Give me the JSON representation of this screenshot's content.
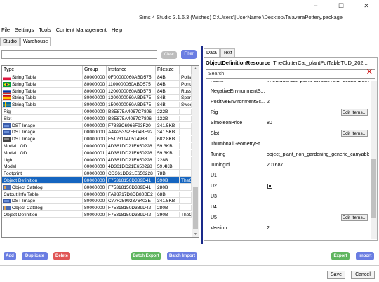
{
  "window": {
    "title": "Sims 4 Studio 3.1.6.3 (Wishes)  C:\\Users\\[UserName]\\Desktop\\TalaveraPottery.package",
    "minimize": "−",
    "maximize": "☐",
    "close": "✕"
  },
  "menu": [
    "File",
    "Settings",
    "Tools",
    "Content Management",
    "Help"
  ],
  "tabs": [
    "Studio",
    "Warehouse"
  ],
  "left": {
    "search_value": "",
    "clear_label": "Clear",
    "filter_label": "Filter",
    "columns": [
      "Type",
      "Group",
      "Instance",
      "Filesize",
      ""
    ],
    "rows": [
      {
        "type": "String Table",
        "group": "80000000",
        "instance": "0F00000060ABD575",
        "size": "84B",
        "extra": "Polish",
        "flag": "pl"
      },
      {
        "type": "String Table",
        "group": "80000000",
        "instance": "1100000060ABD575",
        "size": "84B",
        "extra": "Portug",
        "flag": "br"
      },
      {
        "type": "String Table",
        "group": "80000000",
        "instance": "1200000060ABD575",
        "size": "84B",
        "extra": "Russia",
        "flag": "ru"
      },
      {
        "type": "String Table",
        "group": "80000000",
        "instance": "1300000060ABD575",
        "size": "84B",
        "extra": "Spanis",
        "flag": "es"
      },
      {
        "type": "String Table",
        "group": "80000000",
        "instance": "1500000060ABD575",
        "size": "84B",
        "extra": "Swedis",
        "flag": "se"
      },
      {
        "type": "Rig",
        "group": "00000000",
        "instance": "B8E875A4067C7806",
        "size": "222B",
        "extra": "",
        "flag": ""
      },
      {
        "type": "Slot",
        "group": "00000000",
        "instance": "B8E875A4067C7806",
        "size": "132B",
        "extra": "",
        "flag": ""
      },
      {
        "type": "DST Image",
        "group": "00000000",
        "instance": "F7883C6966F93F20",
        "size": "341.5KB",
        "extra": "",
        "flag": "dst"
      },
      {
        "type": "DST Image",
        "group": "00000000",
        "instance": "A4A253S2EF04BE92",
        "size": "341.5KB",
        "extra": "",
        "flag": "dst"
      },
      {
        "type": "DST Image",
        "group": "00000000",
        "instance": "F51231940514988",
        "size": "682.8KB",
        "extra": "",
        "flag": "dst2"
      },
      {
        "type": "Model LOD",
        "group": "00000000",
        "instance": "4D361DD21E650228",
        "size": "59.3KB",
        "extra": "",
        "flag": ""
      },
      {
        "type": "Model LOD",
        "group": "00000001",
        "instance": "4D361DD21E650228",
        "size": "59.3KB",
        "extra": "",
        "flag": ""
      },
      {
        "type": "Light",
        "group": "00000000",
        "instance": "4D361DD21E650228",
        "size": "228B",
        "extra": "",
        "flag": ""
      },
      {
        "type": "Model",
        "group": "00000000",
        "instance": "4D361DD21E650228",
        "size": "59.4KB",
        "extra": "",
        "flag": ""
      },
      {
        "type": "Footprint",
        "group": "80000000",
        "instance": "CD361DD21E650228",
        "size": "78B",
        "extra": "",
        "flag": ""
      },
      {
        "type": "Object Definition",
        "group": "80000000",
        "instance": "F75318150D389D41",
        "size": "390B",
        "extra": "TheClu",
        "flag": "",
        "selected": true
      },
      {
        "type": "Object Catalog",
        "group": "80000000",
        "instance": "F75318150D389D41",
        "size": "280B",
        "extra": "",
        "flag": "cat"
      },
      {
        "type": "Cutout Info Table",
        "group": "80000000",
        "instance": "FA93717D8DB80BE2",
        "size": "68B",
        "extra": "",
        "flag": ""
      },
      {
        "type": "DST Image",
        "group": "80000000",
        "instance": "C77F25992376403E",
        "size": "341.5KB",
        "extra": "",
        "flag": "dst"
      },
      {
        "type": "Object Catalog",
        "group": "80000000",
        "instance": "F75318150D389D42",
        "size": "280B",
        "extra": "",
        "flag": "cat"
      },
      {
        "type": "Object Definition",
        "group": "80000000",
        "instance": "F75318150D389D42",
        "size": "390B",
        "extra": "TheClu",
        "flag": ""
      }
    ]
  },
  "right": {
    "tabs": [
      "Data",
      "Text"
    ],
    "resource_type": "ObjectDefinitionResource",
    "resource_name": "TheClutterCat_plantPotTableTUD_202...",
    "search_placeholder": "Search",
    "edit_label": "Edit Items...",
    "props": [
      {
        "name": "Name",
        "value": "TheClutterCat_plantPotTableTUD_202204201403"
      },
      {
        "name": "NegativeEnvironmentS...",
        "value": ""
      },
      {
        "name": "PositiveEnvironmentSc...",
        "value": "2"
      },
      {
        "name": "Rig",
        "value": "",
        "edit": true
      },
      {
        "name": "SimoleonPrice",
        "value": "80"
      },
      {
        "name": "Slot",
        "value": "",
        "edit": true
      },
      {
        "name": "ThumbnailGeometrySt...",
        "value": ""
      },
      {
        "name": "Tuning",
        "value": "object_plant_non_gardening_generic_carryable"
      },
      {
        "name": "TuningId",
        "value": "201687"
      },
      {
        "name": "U1",
        "value": ""
      },
      {
        "name": "U2",
        "value": "",
        "checkbox": true
      },
      {
        "name": "U3",
        "value": ""
      },
      {
        "name": "U4",
        "value": ""
      },
      {
        "name": "U5",
        "value": "",
        "edit": true
      },
      {
        "name": "Version",
        "value": "2"
      }
    ]
  },
  "actions": {
    "add": "Add",
    "duplicate": "Duplicate",
    "delete": "Delete",
    "batch_export": "Batch Export",
    "batch_import": "Batch Import",
    "export": "Export",
    "import": "Import"
  },
  "footer": {
    "save": "Save",
    "cancel": "Cancel"
  },
  "colors": {
    "blue": "#6a7de2",
    "red": "#e05555",
    "green": "#5fb55f",
    "selection": "#1565c0"
  }
}
